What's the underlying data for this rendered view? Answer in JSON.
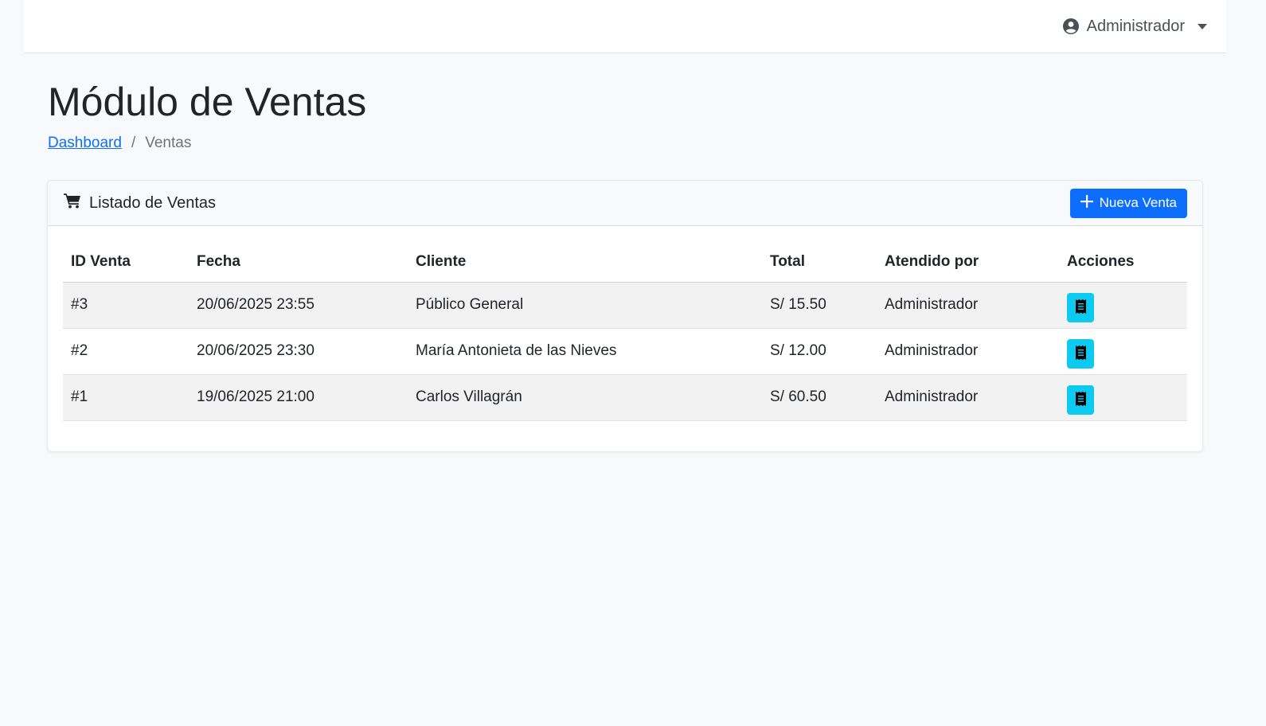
{
  "topbar": {
    "user_name": "Administrador",
    "user_icon": "user-circle-icon",
    "caret_icon": "caret-down-icon"
  },
  "page": {
    "title": "Módulo de Ventas",
    "breadcrumb": {
      "home": "Dashboard",
      "separator": "/",
      "current": "Ventas"
    }
  },
  "card": {
    "title": "Listado de Ventas",
    "title_icon": "cart-icon",
    "new_button_label": "Nueva Venta",
    "new_button_icon": "plus-icon"
  },
  "table": {
    "headers": [
      "ID Venta",
      "Fecha",
      "Cliente",
      "Total",
      "Atendido por",
      "Acciones"
    ],
    "rows": [
      {
        "id": "#3",
        "fecha": "20/06/2025 23:55",
        "cliente": "Público General",
        "total": "S/ 15.50",
        "atendido": "Administrador",
        "action_icon": "receipt-icon"
      },
      {
        "id": "#2",
        "fecha": "20/06/2025 23:30",
        "cliente": "María Antonieta de las Nieves",
        "total": "S/ 12.00",
        "atendido": "Administrador",
        "action_icon": "receipt-icon"
      },
      {
        "id": "#1",
        "fecha": "19/06/2025 21:00",
        "cliente": "Carlos Villagrán",
        "total": "S/ 60.50",
        "atendido": "Administrador",
        "action_icon": "receipt-icon"
      }
    ]
  },
  "colors": {
    "primary": "#0d6efd",
    "info": "#0dcaf0",
    "background": "#f8f9fa"
  }
}
